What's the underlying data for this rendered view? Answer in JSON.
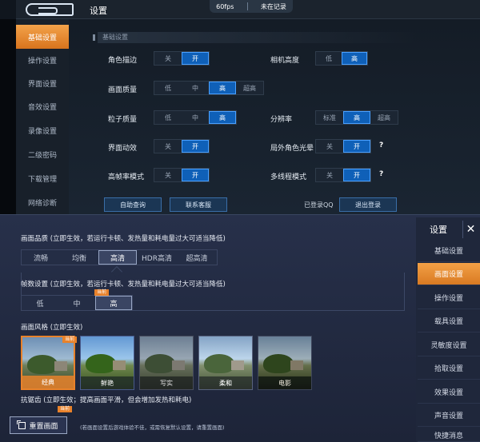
{
  "top": {
    "title": "设置",
    "fps": "60fps",
    "record_status": "未在记录",
    "sidebar": [
      "基础设置",
      "操作设置",
      "界面设置",
      "音效设置",
      "录像设置",
      "二级密码",
      "下载管理",
      "网络诊断"
    ],
    "section": "基础设置",
    "options": {
      "role_outline": {
        "label": "角色描边",
        "choices": [
          "关",
          "开"
        ],
        "selected": 1
      },
      "camera_height": {
        "label": "相机高度",
        "choices": [
          "低",
          "高"
        ],
        "selected": 1
      },
      "graphics_quality": {
        "label": "画面质量",
        "choices": [
          "低",
          "中",
          "高",
          "超高"
        ],
        "selected": 2
      },
      "particle_quality": {
        "label": "粒子质量",
        "choices": [
          "低",
          "中",
          "高"
        ],
        "selected": 2
      },
      "resolution": {
        "label": "分辨率",
        "choices": [
          "标准",
          "高",
          "超高"
        ],
        "selected": 1
      },
      "ui_animation": {
        "label": "界面动效",
        "choices": [
          "关",
          "开"
        ],
        "selected": 1
      },
      "outfield_glow": {
        "label": "局外角色光晕",
        "choices": [
          "关",
          "开"
        ],
        "selected": 1
      },
      "high_fps": {
        "label": "高帧率模式",
        "choices": [
          "关",
          "开"
        ],
        "selected": 1
      },
      "multithread": {
        "label": "多线程模式",
        "choices": [
          "关",
          "开"
        ],
        "selected": 1
      }
    },
    "buttons": {
      "self_help": "自助查询",
      "contact": "联系客服",
      "logged_in": "已登录QQ",
      "logout": "退出登录"
    }
  },
  "bottom": {
    "quality": {
      "title": "画面品质 (立即生效，若运行卡顿、发热量和耗电量过大可适当降低)",
      "choices": [
        "流畅",
        "均衡",
        "高清",
        "HDR高清",
        "超高清"
      ],
      "selected": 2
    },
    "fps": {
      "title": "帧数设置 (立即生效，若运行卡顿、发热量和耗电量过大可适当降低)",
      "choices": [
        "低",
        "中",
        "高"
      ],
      "selected": 2,
      "badge": "当前"
    },
    "style": {
      "title": "画面风格 (立即生效)",
      "choices": [
        "经典",
        "鲜艳",
        "写实",
        "柔和",
        "电影"
      ],
      "selected": 0,
      "badge": "当前"
    },
    "antialias": {
      "title": "抗锯齿 (立即生效；提高画面平滑，但会增加发热和耗电)",
      "badge": "当前"
    },
    "reset_label": "重置画面",
    "reset_note": "(若画面设置后游戏体验不佳，或需恢复默认设置，请重置画面)",
    "side_title": "设置",
    "close": "✕",
    "sidebar": [
      "基础设置",
      "画面设置",
      "操作设置",
      "载具设置",
      "灵敏度设置",
      "拾取设置",
      "效果设置",
      "声音设置",
      "快捷消息"
    ],
    "sidebar_selected": 1
  }
}
